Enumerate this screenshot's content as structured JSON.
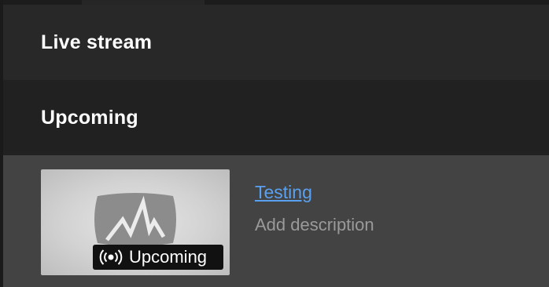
{
  "sections": {
    "live_stream": {
      "title": "Live stream"
    },
    "upcoming": {
      "title": "Upcoming"
    }
  },
  "upcoming_item": {
    "title": "Testing",
    "description_placeholder": "Add description",
    "badge_label": "Upcoming",
    "badge_icon": "broadcast-icon",
    "thumbnail_icon": "live-pulse-logo-icon"
  },
  "colors": {
    "link": "#5aa0f0",
    "badge_bg": "#111111"
  }
}
